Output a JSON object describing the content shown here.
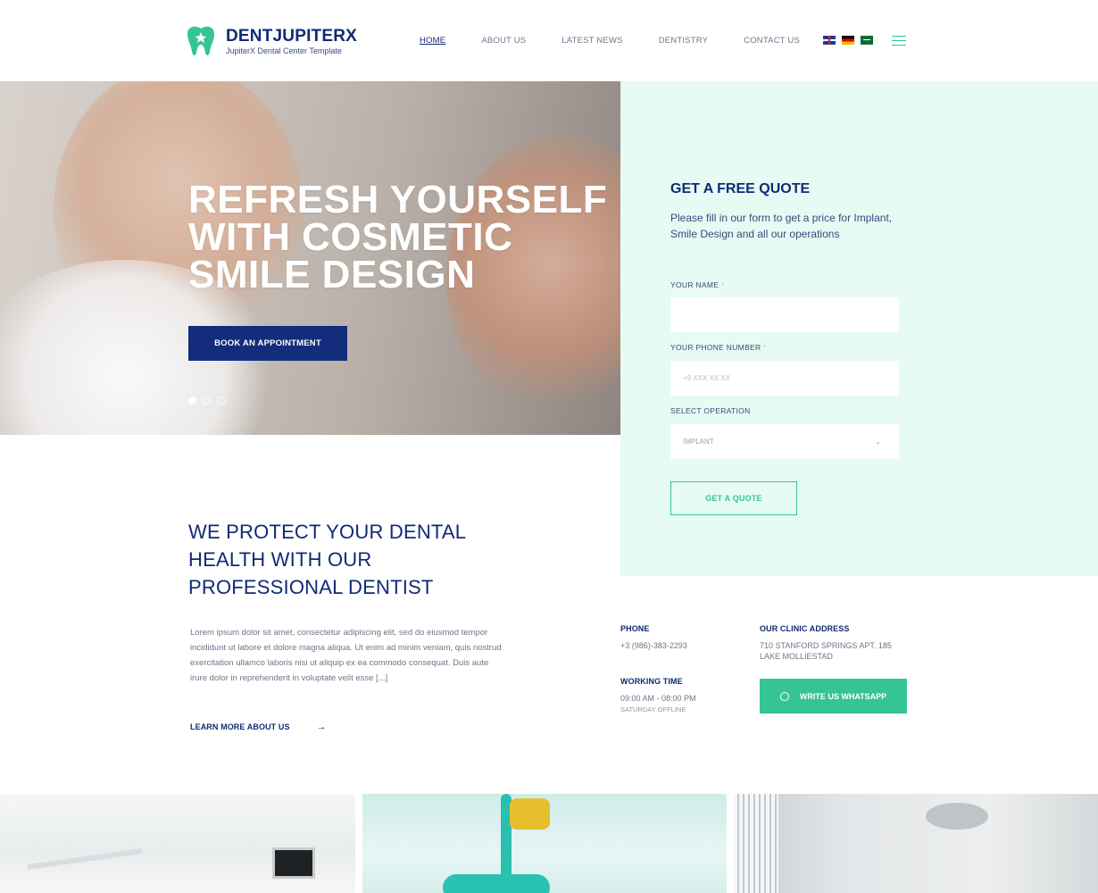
{
  "brand": {
    "name": "DENTJUPITERX",
    "tagline": "JupiterX Dental Center Template"
  },
  "nav": {
    "items": [
      {
        "label": "HOME",
        "active": true
      },
      {
        "label": "ABOUT US",
        "active": false
      },
      {
        "label": "LATEST NEWS",
        "active": false
      },
      {
        "label": "DENTISTRY",
        "active": false
      },
      {
        "label": "CONTACT US",
        "active": false
      }
    ]
  },
  "languages": [
    "english-flag",
    "german-flag",
    "saudi-flag"
  ],
  "hero": {
    "title": "REFRESH YOURSELF WITH COSMETIC SMILE DESIGN",
    "button": "BOOK AN APPOINTMENT",
    "slides": 3,
    "active_slide": 1
  },
  "quote": {
    "title": "GET A FREE QUOTE",
    "description": "Please fill in our form to get a price for Implant, Smile Design and all our operations",
    "name_label": "YOUR NAME",
    "required_mark": "*",
    "phone_label": "YOUR PHONE NUMBER",
    "phone_placeholder": "+9 XXX XX XX",
    "operation_label": "SELECT OPERATION",
    "operation_value": "IMPLANT",
    "button": "GET A QUOTE"
  },
  "about": {
    "title": "WE PROTECT YOUR DENTAL HEALTH WITH OUR PROFESSIONAL DENTIST",
    "text": "Lorem ipsum dolor sit amet, consectetur adipiscing elit, sed do eiusmod tempor incididunt ut labore et dolore magna aliqua. Ut enim ad minim veniam, quis nostrud exercitation ullamco laboris nisi ut aliquip ex ea commodo consequat. Duis aute irure dolor in reprehenderit in voluptate velit esse [...]",
    "link": "LEARN MORE ABOUT US",
    "link_arrow": "→"
  },
  "contact": {
    "phone_label": "PHONE",
    "phone": "+3 (986)-383-2293",
    "address_label": "OUR CLINIC ADDRESS",
    "address_line1": "710 STANFORD SPRINGS APT. 185",
    "address_line2": "LAKE MOLLIESTAD",
    "hours_label": "WORKING TIME",
    "hours": "09:00 AM - 08:00 PM",
    "hours_note": "SATURDAY OFFLINE",
    "whatsapp_button": "WRITE US WHATSAPP"
  },
  "colors": {
    "primary": "#132d7c",
    "accent": "#35c496",
    "panel_bg": "#e5fbf3"
  }
}
